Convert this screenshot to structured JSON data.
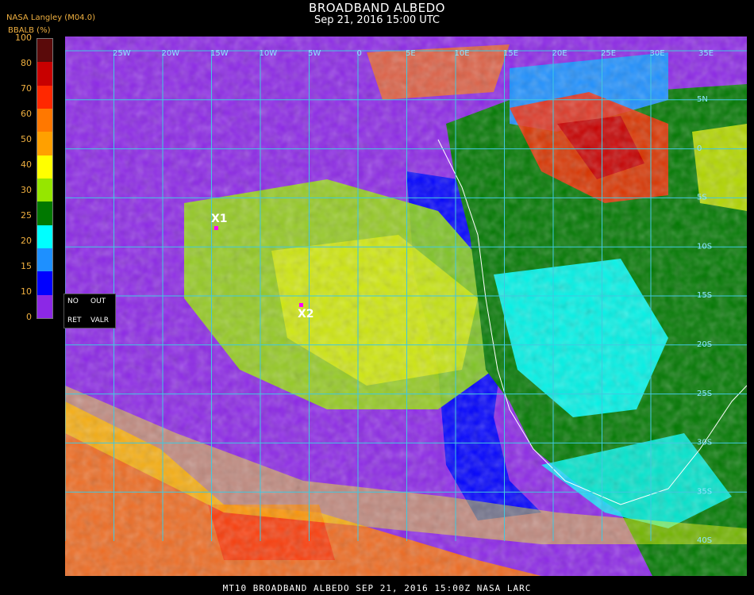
{
  "header": {
    "title": "BROADBAND ALBEDO",
    "subtitle": "Sep 21, 2016 15:00 UTC",
    "org": "NASA Langley (M04.0)",
    "units": "BBALB (%)"
  },
  "legend": {
    "ticks": [
      "100",
      "80",
      "70",
      "60",
      "50",
      "40",
      "30",
      "25",
      "20",
      "15",
      "10",
      "0"
    ],
    "colors": [
      "#5a0a0a",
      "#c80000",
      "#ff2800",
      "#ff7800",
      "#ffa000",
      "#ffff00",
      "#96e600",
      "#007800",
      "#00ffff",
      "#1e90ff",
      "#0000ff",
      "#8c28e6"
    ]
  },
  "overlay": {
    "no_label": "NO",
    "out_label": "OUT",
    "ret_label": "RET",
    "valr_label": "VALR"
  },
  "markers": [
    {
      "label": "X1"
    },
    {
      "label": "X2"
    }
  ],
  "grid_labels": {
    "lon": [
      "25W",
      "20W",
      "15W",
      "10W",
      "5W",
      "0",
      "5E",
      "10E",
      "15E",
      "20E",
      "25E",
      "30E",
      "35E"
    ],
    "lat": [
      "5N",
      "0",
      "5S",
      "10S",
      "15S",
      "20S",
      "25S",
      "30S",
      "35S",
      "40S"
    ]
  },
  "footer": "MT10  BROADBAND ALBEDO  SEP 21, 2016 15:00Z  NASA LARC"
}
